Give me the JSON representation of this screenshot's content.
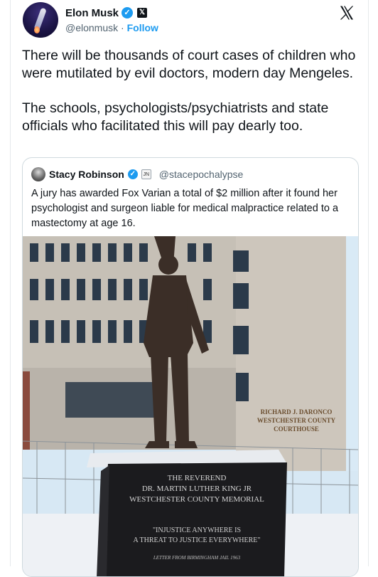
{
  "author": {
    "name": "Elon Musk",
    "handle": "@elonmusk",
    "separator": "·",
    "follow_label": "Follow",
    "verified_mark": "✓",
    "org_badge": "𝕏"
  },
  "platform_logo": "x-logo-icon",
  "tweet": {
    "paragraphs": [
      "There will be thousands of court cases of children who were mutilated by evil doctors, modern day Mengeles.",
      "The schools, psychologists/psychiatrists and state officials who facilitated this will pay dearly too."
    ]
  },
  "quoted_tweet": {
    "name": "Stacy Robinson",
    "verified_mark": "✓",
    "org_badge": "JN",
    "handle": "@stacepochalypse",
    "text": "A jury has awarded Fox Varian a total of $2 million after it found her psychologist and surgeon liable for medical malpractice related to a mastectomy at age 16.",
    "image": {
      "building_sign": [
        "RICHARD J. DARONCO",
        "WESTCHESTER COUNTY",
        "COURTHOUSE"
      ],
      "memorial_lines": [
        "THE REVEREND",
        "DR. MARTIN LUTHER KING JR",
        "WESTCHESTER COUNTY MEMORIAL"
      ],
      "quote_lines": [
        "\"INJUSTICE ANYWHERE IS",
        "A THREAT TO JUSTICE EVERYWHERE\""
      ],
      "citation": "LETTER FROM BIRMINGHAM JAIL 1963"
    }
  },
  "colors": {
    "accent": "#1d9bf0",
    "text": "#0f1419",
    "muted": "#536471",
    "border": "#cfd9de",
    "sky": "#cfe4f2",
    "building": "#c9c3ba",
    "statue": "#3a2e28",
    "pedestal": "#1a1a1c",
    "snow": "#f2f4f7"
  }
}
